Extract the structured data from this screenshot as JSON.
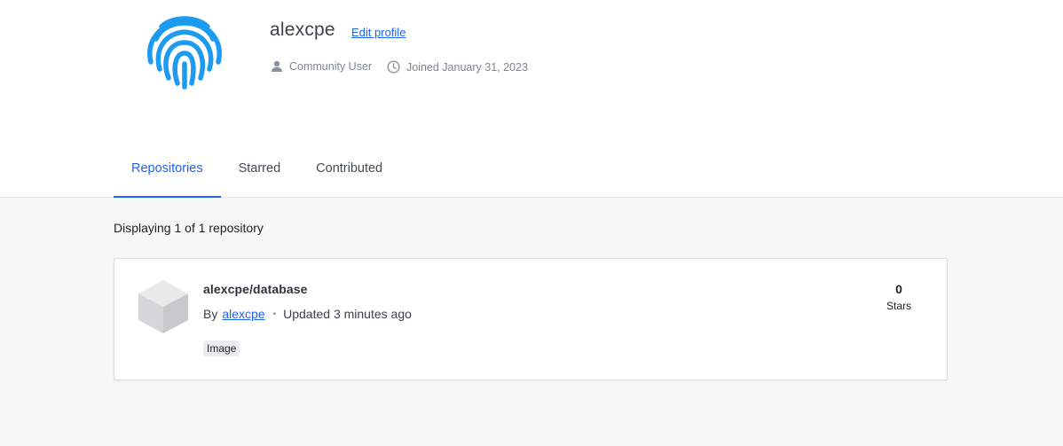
{
  "profile": {
    "username": "alexcpe",
    "edit_label": "Edit profile",
    "role": "Community User",
    "joined": "Joined January 31, 2023",
    "avatar_icon": "fingerprint-icon",
    "accent": "#1d9bf0"
  },
  "tabs": [
    {
      "label": "Repositories",
      "active": true
    },
    {
      "label": "Starred",
      "active": false
    },
    {
      "label": "Contributed",
      "active": false
    }
  ],
  "listing": {
    "count_text": "Displaying 1 of 1 repository"
  },
  "repositories": [
    {
      "name": "alexcpe/database",
      "by_label": "By",
      "owner": "alexcpe",
      "separator": "•",
      "updated": "Updated 3 minutes ago",
      "badge": "Image",
      "stars": "0",
      "stars_label": "Stars",
      "icon": "cube-icon"
    }
  ],
  "colors": {
    "link": "#1d63ed",
    "background": "#f7f7f7"
  }
}
